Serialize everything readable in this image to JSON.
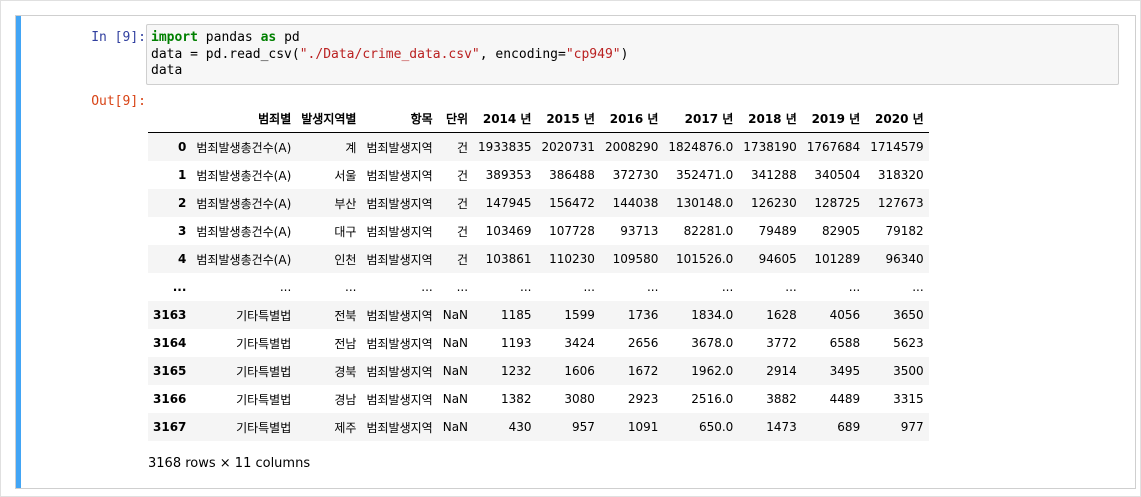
{
  "input_prompt": "In [9]:",
  "output_prompt": "Out[9]:",
  "code": {
    "line1": {
      "kw1": "import",
      "mod": " pandas ",
      "kw2": "as",
      "alias": " pd"
    },
    "line2": {
      "pre": "data = pd.read_csv(",
      "path": "\"./Data/crime_data.csv\"",
      "mid": ", encoding=",
      "enc": "\"cp949\"",
      "post": ")"
    },
    "line3": "data"
  },
  "table": {
    "columns": [
      "",
      "범죄별",
      "발생지역별",
      "항목",
      "단위",
      "2014 년",
      "2015 년",
      "2016 년",
      "2017 년",
      "2018 년",
      "2019 년",
      "2020 년"
    ],
    "rows": [
      [
        "0",
        "범죄발생총건수(A)",
        "계",
        "범죄발생지역",
        "건",
        "1933835",
        "2020731",
        "2008290",
        "1824876.0",
        "1738190",
        "1767684",
        "1714579"
      ],
      [
        "1",
        "범죄발생총건수(A)",
        "서울",
        "범죄발생지역",
        "건",
        "389353",
        "386488",
        "372730",
        "352471.0",
        "341288",
        "340504",
        "318320"
      ],
      [
        "2",
        "범죄발생총건수(A)",
        "부산",
        "범죄발생지역",
        "건",
        "147945",
        "156472",
        "144038",
        "130148.0",
        "126230",
        "128725",
        "127673"
      ],
      [
        "3",
        "범죄발생총건수(A)",
        "대구",
        "범죄발생지역",
        "건",
        "103469",
        "107728",
        "93713",
        "82281.0",
        "79489",
        "82905",
        "79182"
      ],
      [
        "4",
        "범죄발생총건수(A)",
        "인천",
        "범죄발생지역",
        "건",
        "103861",
        "110230",
        "109580",
        "101526.0",
        "94605",
        "101289",
        "96340"
      ],
      [
        "...",
        "...",
        "...",
        "...",
        "...",
        "...",
        "...",
        "...",
        "...",
        "...",
        "...",
        "..."
      ],
      [
        "3163",
        "기타특별법",
        "전북",
        "범죄발생지역",
        "NaN",
        "1185",
        "1599",
        "1736",
        "1834.0",
        "1628",
        "4056",
        "3650"
      ],
      [
        "3164",
        "기타특별법",
        "전남",
        "범죄발생지역",
        "NaN",
        "1193",
        "3424",
        "2656",
        "3678.0",
        "3772",
        "6588",
        "5623"
      ],
      [
        "3165",
        "기타특별법",
        "경북",
        "범죄발생지역",
        "NaN",
        "1232",
        "1606",
        "1672",
        "1962.0",
        "2914",
        "3495",
        "3500"
      ],
      [
        "3166",
        "기타특별법",
        "경남",
        "범죄발생지역",
        "NaN",
        "1382",
        "3080",
        "2923",
        "2516.0",
        "3882",
        "4489",
        "3315"
      ],
      [
        "3167",
        "기타특별법",
        "제주",
        "범죄발생지역",
        "NaN",
        "430",
        "957",
        "1091",
        "650.0",
        "1473",
        "689",
        "977"
      ]
    ]
  },
  "summary": "3168 rows × 11 columns",
  "colors": {
    "cell_bar": "#42a5f5",
    "in_prompt": "#303f9f",
    "out_prompt": "#d84315",
    "keyword": "#008000",
    "string": "#ba2121"
  }
}
